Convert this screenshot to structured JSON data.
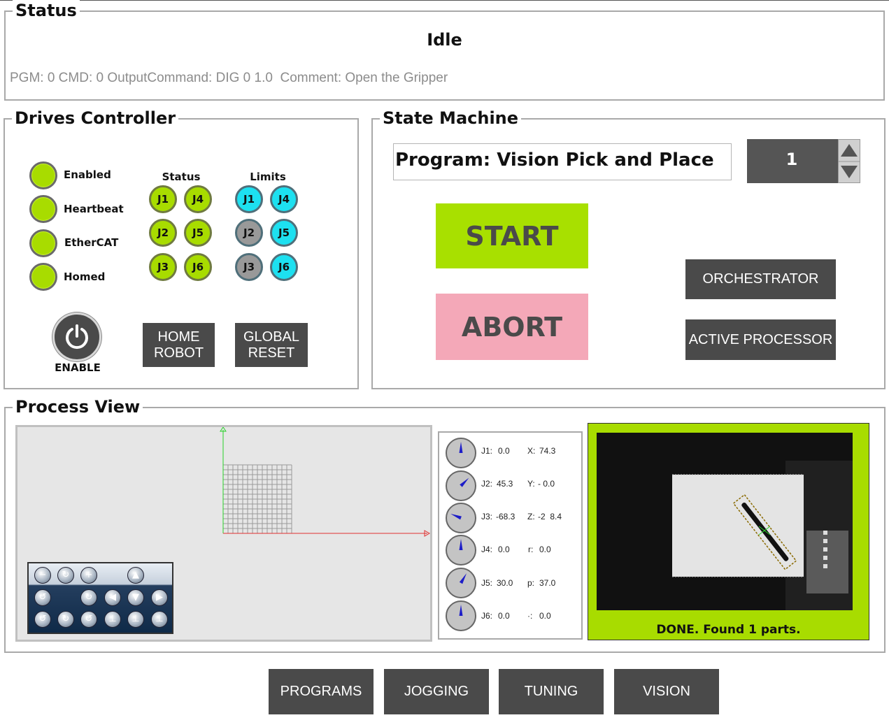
{
  "status": {
    "title": "Status",
    "state": "Idle",
    "detail": "PGM: 0 CMD: 0 OutputCommand: DIG 0 1.0  Comment: Open the Gripper"
  },
  "drives": {
    "title": "Drives Controller",
    "indicators": [
      "Enabled",
      "Heartbeat",
      "EtherCAT",
      "Homed"
    ],
    "status_header": "Status",
    "limits_header": "Limits",
    "status_joints": [
      "J1",
      "J4",
      "J2",
      "J5",
      "J3",
      "J6"
    ],
    "limits_joints": [
      "J1",
      "J4",
      "J2",
      "J5",
      "J3",
      "J6"
    ],
    "enable_label": "ENABLE",
    "home_label_1": "HOME",
    "home_label_2": "ROBOT",
    "reset_label_1": "GLOBAL",
    "reset_label_2": "RESET",
    "colors": {
      "ok": "#a8dc00",
      "limit_ok": "#1de0f0",
      "limit_off": "#999999"
    }
  },
  "state_machine": {
    "title": "State Machine",
    "program": "Program: Vision Pick and Place",
    "program_number": "1",
    "start_label": "START",
    "abort_label": "ABORT",
    "orchestrator_label": "ORCHESTRATOR",
    "active_processor_label": "ACTIVE PROCESSOR",
    "colors": {
      "start": "#a8e000",
      "abort": "#f4a8b8"
    }
  },
  "process": {
    "title": "Process View",
    "joints": [
      {
        "label": "J1:",
        "value": "0.0",
        "axis": "X:",
        "axis_value": "74.3",
        "angle": 0
      },
      {
        "label": "J2:",
        "value": "45.3",
        "axis": "Y:",
        "axis_value": "- 0.0",
        "angle": 45
      },
      {
        "label": "J3:",
        "value": "-68.3",
        "axis": "Z:",
        "axis_value": "-2  8.4",
        "angle": -68
      },
      {
        "label": "J4:",
        "value": "0.0",
        "axis": "r:",
        "axis_value": "0.0",
        "angle": 0
      },
      {
        "label": "J5:",
        "value": "30.0",
        "axis": "p:",
        "axis_value": "37.0",
        "angle": 30
      },
      {
        "label": "J6:",
        "value": "0.0",
        "axis": "·:",
        "axis_value": "0.0",
        "angle": 0
      }
    ],
    "vision_message": "DONE. Found 1 parts."
  },
  "tabs": [
    "PROGRAMS",
    "JOGGING",
    "TUNING",
    "VISION"
  ]
}
